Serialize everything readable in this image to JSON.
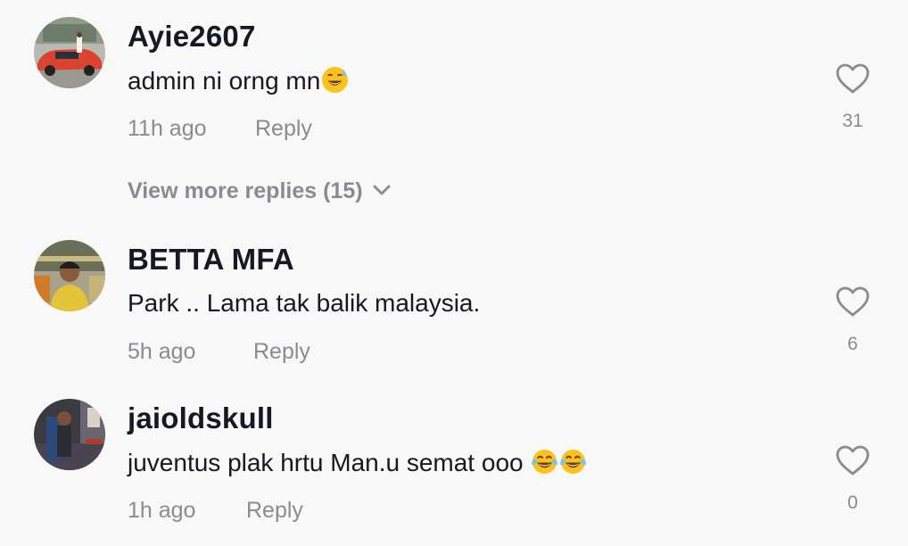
{
  "comments": [
    {
      "username": "Ayie2607",
      "text": "admin ni orng mn",
      "emoji": "sweat-smile-emoji",
      "time": "11h ago",
      "reply_label": "Reply",
      "likes": "31",
      "avatar": "avatar-red-car"
    },
    {
      "username": "BETTA MFA",
      "text": "Park .. Lama tak balik malaysia.",
      "emoji": "",
      "time": "5h ago",
      "reply_label": "Reply",
      "likes": "6",
      "avatar": "avatar-man-yellow-shirt"
    },
    {
      "username": "jaioldskull",
      "text": "juventus plak hrtu Man.u semat ooo ",
      "emoji": "tears-of-joy-emoji x2",
      "time": "1h ago",
      "reply_label": "Reply",
      "likes": "0",
      "avatar": "avatar-dark-photo"
    }
  ],
  "view_more_replies": "View more replies (15)",
  "icons": {
    "like": "heart-outline-icon",
    "expand": "chevron-down-icon"
  },
  "colors": {
    "background": "#f8f8f8",
    "primary_text": "#161823",
    "secondary_text": "#8a8b91"
  }
}
